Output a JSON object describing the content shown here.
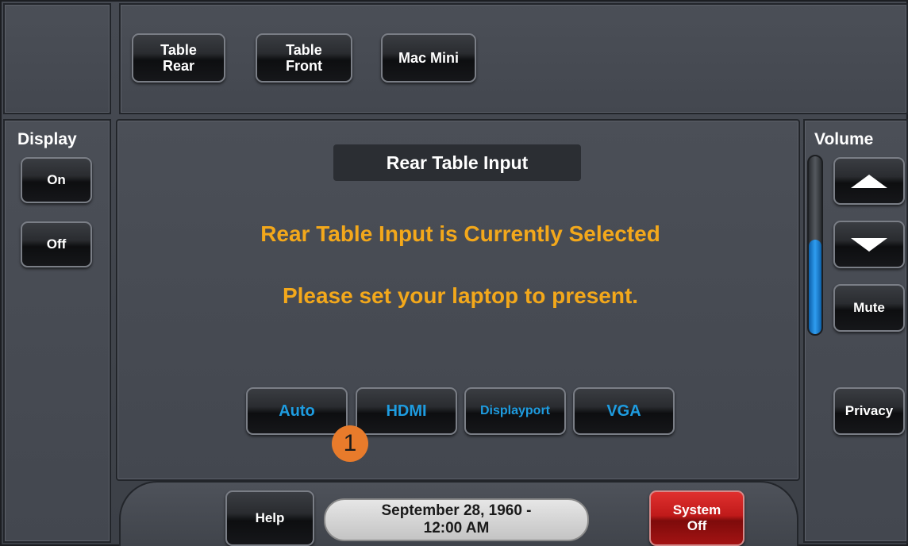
{
  "top_bar": {
    "sources": [
      {
        "label": "Table\nRear"
      },
      {
        "label": "Table\nFront"
      },
      {
        "label": "Mac Mini"
      }
    ]
  },
  "display": {
    "heading": "Display",
    "on_label": "On",
    "off_label": "Off"
  },
  "main": {
    "title": "Rear Table Input",
    "message_line1": "Rear Table Input is Currently Selected",
    "message_line2": "Please set your laptop to present.",
    "input_modes": [
      "Auto",
      "HDMI",
      "Displayport",
      "VGA"
    ]
  },
  "volume": {
    "heading": "Volume",
    "level_percent": 53,
    "up_icon": "triangle-up-icon",
    "down_icon": "triangle-down-icon",
    "mute_label": "Mute",
    "privacy_label": "Privacy"
  },
  "bottom_bar": {
    "help_label": "Help",
    "date": "September 28, 1960  -",
    "time": "12:00 AM",
    "system_off_label": "System\nOff"
  },
  "annotation": {
    "marker": "1"
  },
  "colors": {
    "message": "#f3a81b",
    "mode_text": "#1e9ce0",
    "system_off": "#c01a1a",
    "volume_fill": "#2f9df0",
    "marker": "#e87b2b"
  }
}
